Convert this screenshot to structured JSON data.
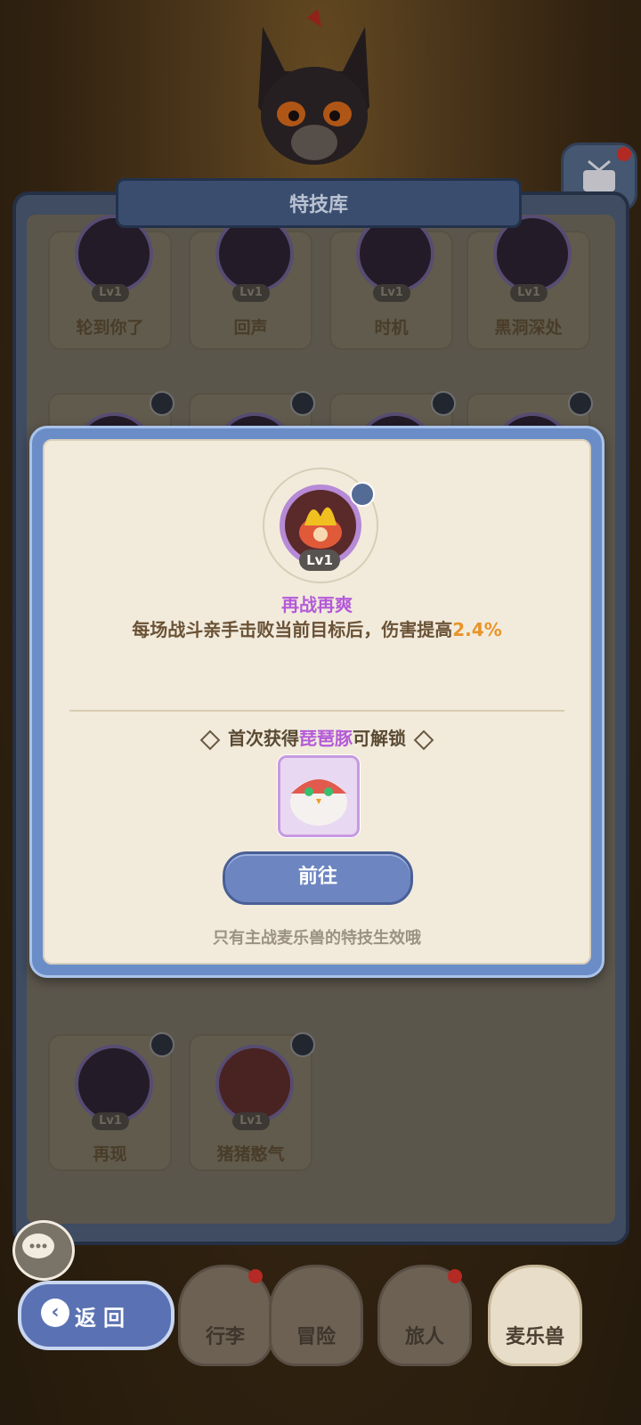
{
  "library": {
    "title": "特技库",
    "row1": [
      "轮到你了",
      "回声",
      "时机",
      "黑洞深处"
    ],
    "level": "Lv1",
    "bottom_row": [
      "再现",
      "猪猪憨气"
    ]
  },
  "modal": {
    "level": "Lv1",
    "skill_name": "再战再爽",
    "desc_prefix": "每场战斗亲手击败当前目标后，伤害提高",
    "desc_value": "2.4%",
    "unlock_prefix": "首次获得",
    "unlock_pet": "琵琶豚",
    "unlock_suffix": "可解锁",
    "go_button": "前往",
    "note": "只有主战麦乐兽的特技生效哦"
  },
  "nav": {
    "items": [
      "行李",
      "冒险",
      "旅人",
      "麦乐兽"
    ],
    "back": "返回"
  },
  "colors": {
    "accent_purple": "#b45ad8",
    "highlight_orange": "#e8942a",
    "button_blue": "#6d85c0"
  }
}
